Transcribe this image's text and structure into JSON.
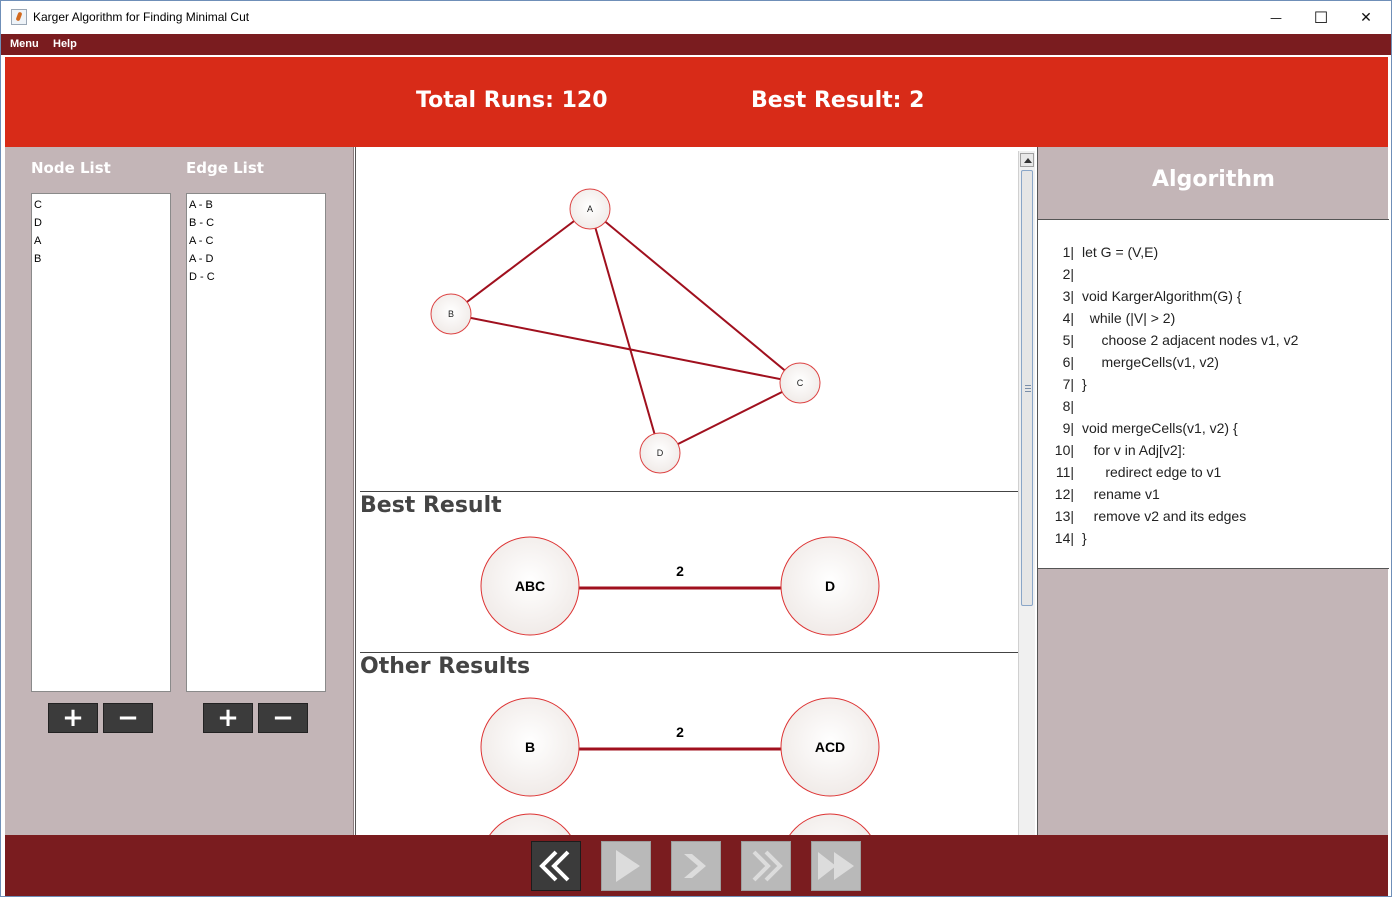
{
  "window": {
    "title": "Karger Algorithm for Finding Minimal Cut",
    "minimize_glyph": "—",
    "maximize_glyph": "☐",
    "close_glyph": "✕"
  },
  "menubar": {
    "items": [
      "Menu",
      "Help"
    ]
  },
  "header": {
    "total_runs": "Total Runs: 120",
    "best_result": "Best Result: 2"
  },
  "left_panel": {
    "node_list_title": "Node List",
    "edge_list_title": "Edge List",
    "nodes": [
      "C",
      "D",
      "A",
      "B"
    ],
    "edges": [
      "A - B",
      "B - C",
      "A - C",
      "A - D",
      "D - C"
    ],
    "add_glyph": "+",
    "remove_glyph": "−"
  },
  "graph": {
    "nodes": [
      {
        "id": "A",
        "label": "A"
      },
      {
        "id": "B",
        "label": "B"
      },
      {
        "id": "C",
        "label": "C"
      },
      {
        "id": "D",
        "label": "D"
      }
    ],
    "edges": [
      [
        "A",
        "B"
      ],
      [
        "B",
        "C"
      ],
      [
        "A",
        "C"
      ],
      [
        "A",
        "D"
      ],
      [
        "D",
        "C"
      ]
    ]
  },
  "best_result": {
    "title": "Best Result",
    "left": "ABC",
    "right": "D",
    "cut": "2"
  },
  "other_results": {
    "title": "Other Results",
    "items": [
      {
        "left": "B",
        "right": "ACD",
        "cut": "2"
      }
    ]
  },
  "algorithm": {
    "title": "Algorithm",
    "lines": [
      {
        "n": "1|",
        "code": "let G = (V,E)"
      },
      {
        "n": "2|",
        "code": ""
      },
      {
        "n": "3|",
        "code": "void KargerAlgorithm(G) {"
      },
      {
        "n": "4|",
        "code": "  while (|V| > 2)"
      },
      {
        "n": "5|",
        "code": "     choose 2 adjacent nodes v1, v2"
      },
      {
        "n": "6|",
        "code": "     mergeCells(v1, v2)"
      },
      {
        "n": "7|",
        "code": "}"
      },
      {
        "n": "8|",
        "code": ""
      },
      {
        "n": "9|",
        "code": "void mergeCells(v1, v2) {"
      },
      {
        "n": "10|",
        "code": "   for v in Adj[v2]:"
      },
      {
        "n": "11|",
        "code": "      redirect edge to v1"
      },
      {
        "n": "12|",
        "code": "   rename v1"
      },
      {
        "n": "13|",
        "code": "   remove v2 and its edges"
      },
      {
        "n": "14|",
        "code": "}"
      }
    ]
  },
  "controls": {
    "buttons": [
      {
        "name": "rewind-button",
        "icon": "double-chevron-left-icon",
        "active": true
      },
      {
        "name": "play-button",
        "icon": "play-icon",
        "active": false
      },
      {
        "name": "step-forward-button",
        "icon": "chevron-right-icon",
        "active": false
      },
      {
        "name": "step-fast-forward-button",
        "icon": "double-chevron-right-icon",
        "active": false
      },
      {
        "name": "fast-forward-button",
        "icon": "fast-forward-icon",
        "active": false
      }
    ]
  },
  "colors": {
    "header_red": "#d82b18",
    "menubar": "#7a1c1f",
    "panel_gray": "#c3b5b7",
    "edge": "#a0101e"
  }
}
